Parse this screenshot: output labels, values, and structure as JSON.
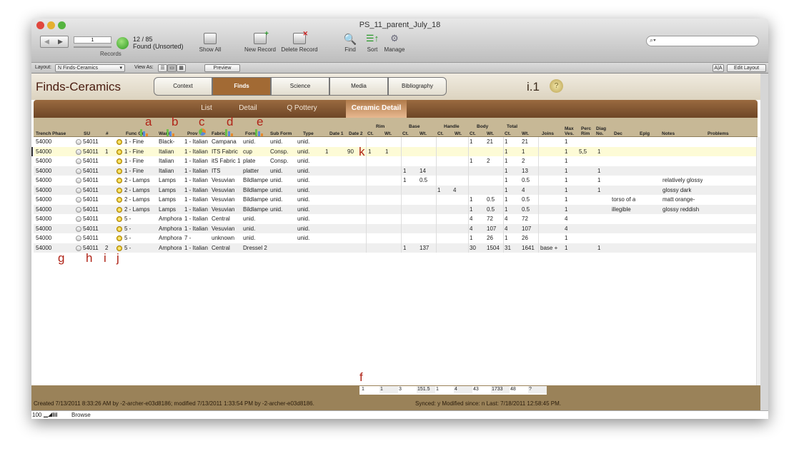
{
  "window": {
    "title": "PS_11_parent_July_18"
  },
  "toolbar": {
    "record_current": "1",
    "records_label": "Records",
    "found_count": "12 / 85",
    "found_status": "Found (Unsorted)",
    "show_all": "Show All",
    "new_record": "New Record",
    "delete_record": "Delete Record",
    "find": "Find",
    "sort": "Sort",
    "manage": "Manage",
    "search_placeholder": ""
  },
  "layoutbar": {
    "layout_label": "Layout:",
    "layout_value": "N Finds-Ceramics",
    "view_as_label": "View As:",
    "preview": "Preview",
    "edit_layout": "Edit Layout",
    "font_btn": "A|A"
  },
  "header": {
    "title": "Finds-Ceramics",
    "version": "i.1",
    "help": "?",
    "tabs": [
      "Context",
      "Finds",
      "Science",
      "Media",
      "Bibliography"
    ],
    "active_tab": "Finds"
  },
  "subtabs": {
    "items": [
      "List",
      "Detail",
      "Q Pottery",
      "Ceramic Detail"
    ],
    "active": "Ceramic Detail"
  },
  "columns": {
    "trench": "Trench Phase",
    "su": "SU",
    "num": "#",
    "func": "Func Gr",
    "ware": "Ware",
    "prov": "Prov",
    "fabric": "Fabric",
    "form": "Form",
    "subform": "Sub Form",
    "type": "Type",
    "date1": "Date 1",
    "date2": "Date 2",
    "rim": "Rim",
    "base": "Base",
    "handle": "Handle",
    "body": "Body",
    "total": "Total",
    "ct": "Ct.",
    "wt": "Wt.",
    "joins": "Joins",
    "maxves": "Max Ves.",
    "percrim": "Perc Rim",
    "diag": "Diag No.",
    "dec": "Dec",
    "eplg": "Eplg",
    "notes": "Notes",
    "problems": "Problems"
  },
  "rows": [
    {
      "trench": "54000",
      "su": "54011",
      "num": "",
      "func": "1 - Fine",
      "ware": "Black-",
      "prov": "1 - Italian",
      "fabric": "Campana",
      "form": "unid.",
      "subform": "unid.",
      "type": "unid.",
      "date1": "",
      "date2": "",
      "rimct": "",
      "rimwt": "",
      "basect": "",
      "basewt": "",
      "handct": "",
      "handwt": "",
      "bodyct": "1",
      "bodywt": "21",
      "totct": "1",
      "totwt": "21",
      "joins": "",
      "maxves": "1",
      "percrim": "",
      "diag": "",
      "dec": "",
      "notes": ""
    },
    {
      "trench": "54000",
      "su": "54011",
      "num": "1",
      "func": "1 - Fine",
      "ware": "Italian",
      "prov": "1 - Italian",
      "fabric": "ITS Fabric",
      "form": "cup",
      "subform": "Consp.",
      "type": "unid.",
      "date1": "1",
      "date2": "90",
      "rimct": "1",
      "rimwt": "1",
      "basect": "",
      "basewt": "",
      "handct": "",
      "handwt": "",
      "bodyct": "",
      "bodywt": "",
      "totct": "1",
      "totwt": "1",
      "joins": "",
      "maxves": "1",
      "percrim": "5,5",
      "diag": "1",
      "dec": "",
      "notes": "",
      "selected": true
    },
    {
      "trench": "54000",
      "su": "54011",
      "num": "",
      "func": "1 - Fine",
      "ware": "Italian",
      "prov": "1 - Italian",
      "fabric": "itS Fabric 1",
      "form": "plate",
      "subform": "Consp.",
      "type": "unid.",
      "date1": "",
      "date2": "",
      "rimct": "",
      "rimwt": "",
      "basect": "",
      "basewt": "",
      "handct": "",
      "handwt": "",
      "bodyct": "1",
      "bodywt": "2",
      "totct": "1",
      "totwt": "2",
      "joins": "",
      "maxves": "1",
      "percrim": "",
      "diag": "",
      "dec": "",
      "notes": ""
    },
    {
      "trench": "54000",
      "su": "54011",
      "num": "",
      "func": "1 - Fine",
      "ware": "Italian",
      "prov": "1 - Italian",
      "fabric": "ITS",
      "form": "platter",
      "subform": "unid.",
      "type": "unid.",
      "date1": "",
      "date2": "",
      "rimct": "",
      "rimwt": "",
      "basect": "1",
      "basewt": "14",
      "handct": "",
      "handwt": "",
      "bodyct": "",
      "bodywt": "",
      "totct": "1",
      "totwt": "13",
      "joins": "",
      "maxves": "1",
      "percrim": "",
      "diag": "1",
      "dec": "",
      "notes": ""
    },
    {
      "trench": "54000",
      "su": "54011",
      "num": "",
      "func": "2 - Lamps",
      "ware": "Lamps",
      "prov": "1 - Italian",
      "fabric": "Vesuvian",
      "form": "Bildlampe",
      "subform": "unid.",
      "type": "unid.",
      "date1": "",
      "date2": "",
      "rimct": "",
      "rimwt": "",
      "basect": "1",
      "basewt": "0.5",
      "handct": "",
      "handwt": "",
      "bodyct": "",
      "bodywt": "",
      "totct": "1",
      "totwt": "0.5",
      "joins": "",
      "maxves": "1",
      "percrim": "",
      "diag": "1",
      "dec": "",
      "notes": "relatively glossy"
    },
    {
      "trench": "54000",
      "su": "54011",
      "num": "",
      "func": "2 - Lamps",
      "ware": "Lamps",
      "prov": "1 - Italian",
      "fabric": "Vesuvian",
      "form": "Bildlampe",
      "subform": "unid.",
      "type": "unid.",
      "date1": "",
      "date2": "",
      "rimct": "",
      "rimwt": "",
      "basect": "",
      "basewt": "",
      "handct": "1",
      "handwt": "4",
      "bodyct": "",
      "bodywt": "",
      "totct": "1",
      "totwt": "4",
      "joins": "",
      "maxves": "1",
      "percrim": "",
      "diag": "1",
      "dec": "",
      "notes": "glossy dark"
    },
    {
      "trench": "54000",
      "su": "54011",
      "num": "",
      "func": "2 - Lamps",
      "ware": "Lamps",
      "prov": "1 - Italian",
      "fabric": "Vesuvian",
      "form": "Bildlampe",
      "subform": "unid.",
      "type": "unid.",
      "date1": "",
      "date2": "",
      "rimct": "",
      "rimwt": "",
      "basect": "",
      "basewt": "",
      "handct": "",
      "handwt": "",
      "bodyct": "1",
      "bodywt": "0.5",
      "totct": "1",
      "totwt": "0.5",
      "joins": "",
      "maxves": "1",
      "percrim": "",
      "diag": "",
      "dec": "torso of a",
      "notes": "matt orange-"
    },
    {
      "trench": "54000",
      "su": "54011",
      "num": "",
      "func": "2 - Lamps",
      "ware": "Lamps",
      "prov": "1 - Italian",
      "fabric": "Vesuvian",
      "form": "Bildlampe",
      "subform": "unid.",
      "type": "unid.",
      "date1": "",
      "date2": "",
      "rimct": "",
      "rimwt": "",
      "basect": "",
      "basewt": "",
      "handct": "",
      "handwt": "",
      "bodyct": "1",
      "bodywt": "0.5",
      "totct": "1",
      "totwt": "0.5",
      "joins": "",
      "maxves": "1",
      "percrim": "",
      "diag": "",
      "dec": "illegible",
      "notes": "glossy reddish"
    },
    {
      "trench": "54000",
      "su": "54011",
      "num": "",
      "func": "5 -",
      "ware": "Amphora",
      "prov": "1 - Italian",
      "fabric": "Central",
      "form": "unid.",
      "subform": "",
      "type": "unid.",
      "date1": "",
      "date2": "",
      "rimct": "",
      "rimwt": "",
      "basect": "",
      "basewt": "",
      "handct": "",
      "handwt": "",
      "bodyct": "4",
      "bodywt": "72",
      "totct": "4",
      "totwt": "72",
      "joins": "",
      "maxves": "4",
      "percrim": "",
      "diag": "",
      "dec": "",
      "notes": ""
    },
    {
      "trench": "54000",
      "su": "54011",
      "num": "",
      "func": "5 -",
      "ware": "Amphora",
      "prov": "1 - Italian",
      "fabric": "Vesuvian",
      "form": "unid.",
      "subform": "",
      "type": "unid.",
      "date1": "",
      "date2": "",
      "rimct": "",
      "rimwt": "",
      "basect": "",
      "basewt": "",
      "handct": "",
      "handwt": "",
      "bodyct": "4",
      "bodywt": "107",
      "totct": "4",
      "totwt": "107",
      "joins": "",
      "maxves": "4",
      "percrim": "",
      "diag": "",
      "dec": "",
      "notes": ""
    },
    {
      "trench": "54000",
      "su": "54011",
      "num": "",
      "func": "5 -",
      "ware": "Amphora",
      "prov": "7 -",
      "fabric": "unknown",
      "form": "unid.",
      "subform": "",
      "type": "unid.",
      "date1": "",
      "date2": "",
      "rimct": "",
      "rimwt": "",
      "basect": "",
      "basewt": "",
      "handct": "",
      "handwt": "",
      "bodyct": "1",
      "bodywt": "26",
      "totct": "1",
      "totwt": "26",
      "joins": "",
      "maxves": "1",
      "percrim": "",
      "diag": "",
      "dec": "",
      "notes": ""
    },
    {
      "trench": "54000",
      "su": "54011",
      "num": "2",
      "func": "5 -",
      "ware": "Amphora",
      "prov": "1 - Italian",
      "fabric": "Central",
      "form": "Dressel 2",
      "subform": "",
      "type": "",
      "date1": "",
      "date2": "",
      "rimct": "",
      "rimwt": "",
      "basect": "1",
      "basewt": "137",
      "handct": "",
      "handwt": "",
      "bodyct": "30",
      "bodywt": "1504",
      "totct": "31",
      "totwt": "1641",
      "joins": "base +",
      "maxves": "1",
      "percrim": "",
      "diag": "1",
      "dec": "",
      "notes": ""
    }
  ],
  "totals": [
    "1",
    "1",
    "3",
    "151.5",
    "1",
    "4",
    "43",
    "1733",
    "48",
    "?"
  ],
  "footer": {
    "created": "Created 7/13/2011 8:33:26 AM by -2-archer-e03d8186; modified 7/13/2011 1:33:54 PM by -2-archer-e03d8186.",
    "synced": "Synced: y Modified since: n Last: 7/18/2011 12:58:45 PM."
  },
  "statusbar": {
    "zoom": "100",
    "mode": "Browse"
  },
  "annotations": [
    "a",
    "b",
    "c",
    "d",
    "e",
    "f",
    "g",
    "h",
    "i",
    "j",
    "k"
  ],
  "colors": {
    "brand_brown": "#7e5432",
    "tab_active": "#a26a34",
    "annotation_red": "#b02418",
    "selected_row": "#fdfbd6",
    "footer": "#9a8259"
  }
}
